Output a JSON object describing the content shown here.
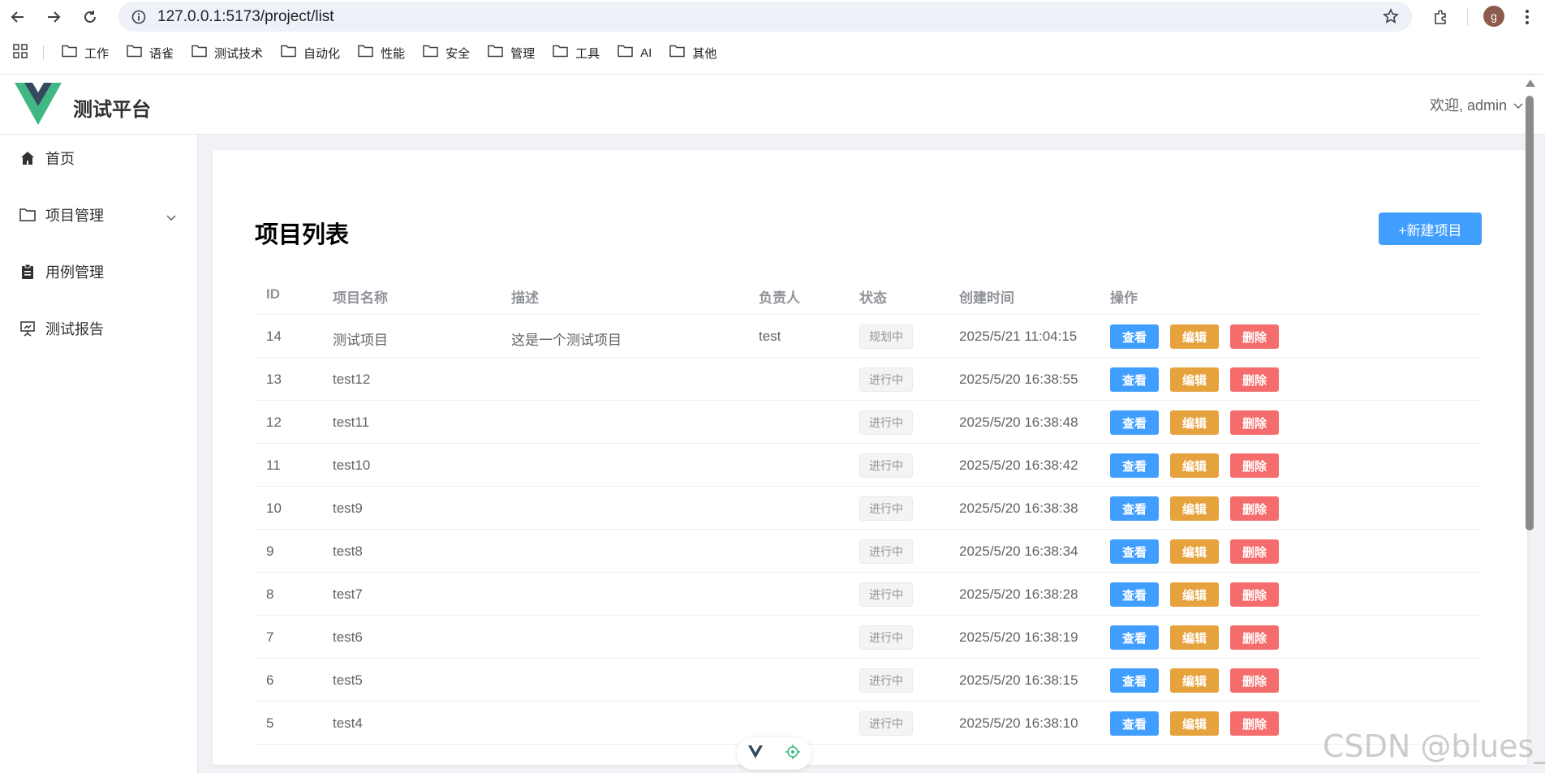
{
  "browser": {
    "url": "127.0.0.1:5173/project/list",
    "avatar_letter": "g",
    "bookmarks": [
      "工作",
      "语雀",
      "测试技术",
      "自动化",
      "性能",
      "安全",
      "管理",
      "工具",
      "AI",
      "其他"
    ]
  },
  "header": {
    "title": "测试平台",
    "user_menu": "欢迎, admin"
  },
  "sidebar": {
    "items": [
      {
        "label": "首页",
        "icon": "home-icon"
      },
      {
        "label": "项目管理",
        "icon": "folder-icon"
      },
      {
        "label": "用例管理",
        "icon": "clipboard-icon"
      },
      {
        "label": "测试报告",
        "icon": "presentation-icon"
      }
    ]
  },
  "page": {
    "title": "项目列表",
    "new_button": "+新建项目"
  },
  "table": {
    "columns": [
      "ID",
      "项目名称",
      "描述",
      "负责人",
      "状态",
      "创建时间",
      "操作"
    ],
    "actions": {
      "view": "查看",
      "edit": "编辑",
      "delete": "删除"
    },
    "rows": [
      {
        "id": "14",
        "name": "测试项目",
        "desc": "这是一个测试项目",
        "owner": "test",
        "status": "规划中",
        "created": "2025/5/21 11:04:15"
      },
      {
        "id": "13",
        "name": "test12",
        "desc": "",
        "owner": "",
        "status": "进行中",
        "created": "2025/5/20 16:38:55"
      },
      {
        "id": "12",
        "name": "test11",
        "desc": "",
        "owner": "",
        "status": "进行中",
        "created": "2025/5/20 16:38:48"
      },
      {
        "id": "11",
        "name": "test10",
        "desc": "",
        "owner": "",
        "status": "进行中",
        "created": "2025/5/20 16:38:42"
      },
      {
        "id": "10",
        "name": "test9",
        "desc": "",
        "owner": "",
        "status": "进行中",
        "created": "2025/5/20 16:38:38"
      },
      {
        "id": "9",
        "name": "test8",
        "desc": "",
        "owner": "",
        "status": "进行中",
        "created": "2025/5/20 16:38:34"
      },
      {
        "id": "8",
        "name": "test7",
        "desc": "",
        "owner": "",
        "status": "进行中",
        "created": "2025/5/20 16:38:28"
      },
      {
        "id": "7",
        "name": "test6",
        "desc": "",
        "owner": "",
        "status": "进行中",
        "created": "2025/5/20 16:38:19"
      },
      {
        "id": "6",
        "name": "test5",
        "desc": "",
        "owner": "",
        "status": "进行中",
        "created": "2025/5/20 16:38:15"
      },
      {
        "id": "5",
        "name": "test4",
        "desc": "",
        "owner": "",
        "status": "进行中",
        "created": "2025/5/20 16:38:10"
      }
    ]
  },
  "watermark": "CSDN @blues_C",
  "colors": {
    "primary": "#409eff",
    "warning": "#e6a23c",
    "danger": "#f56c6c",
    "logo_green": "#41b883",
    "logo_dark": "#35495e"
  }
}
